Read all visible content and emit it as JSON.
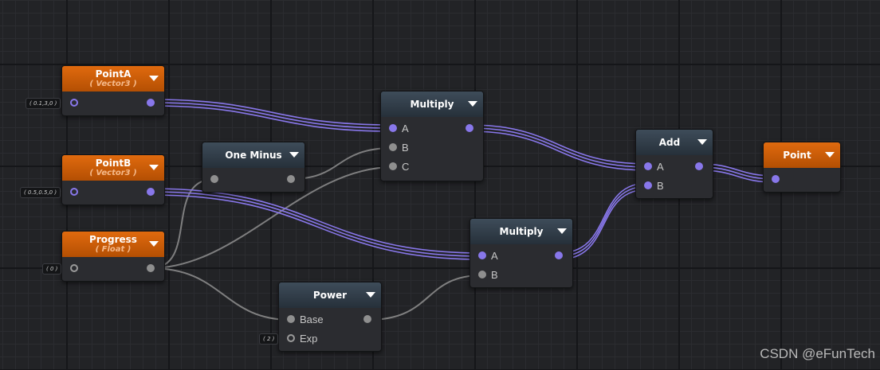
{
  "nodes": {
    "pointA": {
      "title": "PointA",
      "subtitle": "( Vector3 )",
      "default_value": "( 0.1,3,0 )"
    },
    "pointB": {
      "title": "PointB",
      "subtitle": "( Vector3 )",
      "default_value": "( 0.5,0.5,0 )"
    },
    "progress": {
      "title": "Progress",
      "subtitle": "( Float )",
      "default_value": "( 0 )"
    },
    "oneMinus": {
      "title": "One Minus"
    },
    "multiply1": {
      "title": "Multiply",
      "inputs": [
        "A",
        "B",
        "C"
      ]
    },
    "multiply2": {
      "title": "Multiply",
      "inputs": [
        "A",
        "B"
      ]
    },
    "power": {
      "title": "Power",
      "inputs": [
        "Base",
        "Exp"
      ],
      "exp_default": "( 2 )"
    },
    "add": {
      "title": "Add",
      "inputs": [
        "A",
        "B"
      ]
    },
    "point": {
      "title": "Point"
    }
  },
  "colors": {
    "vector_wire": "#8877ea",
    "float_wire": "#8f8f8f",
    "header_orange": "#d25e08",
    "header_gray": "#34414e"
  },
  "watermark": "CSDN @eFunTech"
}
